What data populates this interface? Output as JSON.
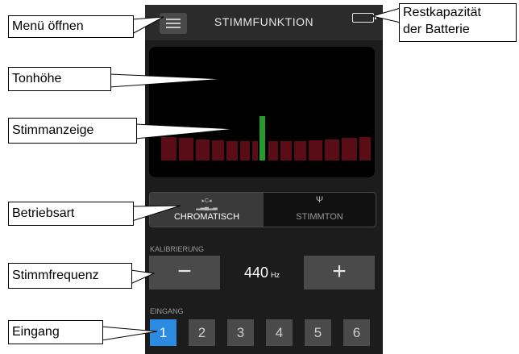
{
  "header": {
    "title": "STIMMFUNKTION",
    "icons": [
      "menu-icon",
      "battery-icon"
    ]
  },
  "tuner": {
    "needle_position": "center",
    "needle_color": "#27992e",
    "segment_color": "#5a0d16"
  },
  "mode": {
    "options": [
      {
        "label": "CHROMATISCH",
        "icon": "chromatic-icon",
        "active": true
      },
      {
        "label": "STIMMTON",
        "icon": "tuning-fork-icon",
        "active": false
      }
    ]
  },
  "calibration": {
    "label": "KALIBRIERUNG",
    "value": "440",
    "unit": "Hz",
    "minus": "−",
    "plus": "+"
  },
  "input": {
    "label": "EINGANG",
    "channels": [
      "1",
      "2",
      "3",
      "4",
      "5",
      "6"
    ],
    "selected": "1",
    "accent": "#2b8be0"
  },
  "callouts": {
    "menu": "Menü öffnen",
    "battery_line1": "Restkapazität",
    "battery_line2": "der Batterie",
    "pitch": "Tonhöhe",
    "tuning": "Stimmanzeige",
    "mode": "Betriebsart",
    "frequency": "Stimmfrequenz",
    "input": "Eingang"
  }
}
